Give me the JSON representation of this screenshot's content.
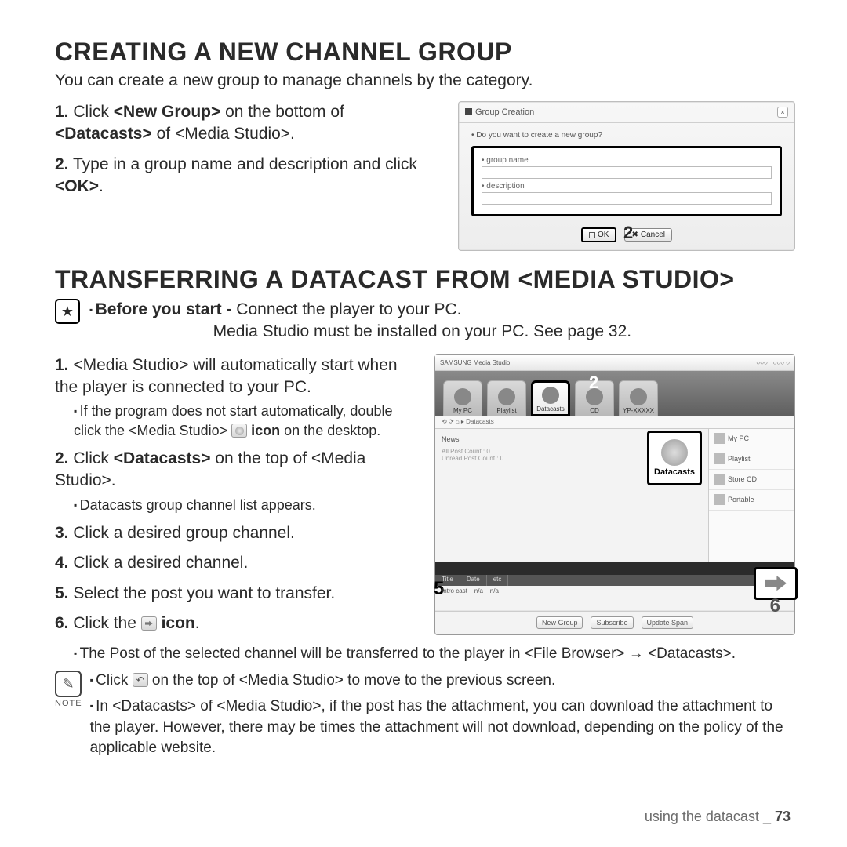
{
  "section1": {
    "title": "CREATING A NEW CHANNEL GROUP",
    "lead": "You can create a new group to manage channels by the category.",
    "steps": [
      {
        "n": "1.",
        "pre": "Click ",
        "b1": "<New Group>",
        "mid": " on the bottom of ",
        "b2": "<Datacasts>",
        "post": " of <Media Studio>."
      },
      {
        "n": "2.",
        "pre": "Type in a group name and description and click ",
        "b1": "<OK>",
        "post": "."
      }
    ]
  },
  "dialog": {
    "title": "Group Creation",
    "question": "Do you want to create a new group?",
    "label_group": "group name",
    "label_desc": "description",
    "callout": "2",
    "ok": "OK",
    "cancel": "Cancel"
  },
  "section2": {
    "title": "TRANSFERRING A DATACAST FROM <MEDIA STUDIO>",
    "before_label": "Before you start - ",
    "before_line1": "Connect the player to your PC.",
    "before_line2": "Media Studio must be installed on your PC. See page 32.",
    "step1": {
      "n": "1.",
      "text": "<Media Studio> will automatically start when the player is connected to your PC."
    },
    "step1_sub_pre": "If the program does not start automatically, double click the <Media Studio> ",
    "step1_sub_post": " on the desktop.",
    "step1_sub_bold": "icon",
    "step2": {
      "n": "2.",
      "pre": "Click ",
      "b": "<Datacasts>",
      "post": " on the top of <Media Studio>."
    },
    "step2_sub": "Datacasts group channel list appears.",
    "step3": {
      "n": "3.",
      "text": "Click a desired group channel."
    },
    "step4": {
      "n": "4.",
      "text": "Click a desired channel."
    },
    "step5": {
      "n": "5.",
      "text": "Select the post you want to transfer."
    },
    "step6": {
      "n": "6.",
      "pre": "Click the ",
      "b": "icon",
      "post": "."
    },
    "step6_sub": "The Post of the selected channel will be transferred to the player in <File Browser> → <Datacasts>."
  },
  "studio": {
    "tabs": [
      "My PC",
      "Playlist",
      "Datacasts",
      "CD",
      "YP-XXXXX"
    ],
    "callout_tabs": "2",
    "path": "Datacasts",
    "left_title": "News",
    "big_label": "Datacasts",
    "right_items": [
      "My PC",
      "Playlist",
      "Store CD",
      "Portable"
    ],
    "list_headers": [
      "Title",
      "Date",
      "etc"
    ],
    "callout_list": "5",
    "callout_transfer": "6",
    "bottom": [
      "New Group",
      "Subscribe",
      "Update Span"
    ]
  },
  "note": {
    "label": "NOTE",
    "line1_pre": "Click ",
    "line1_post": " on the top of <Media Studio> to move to the previous screen.",
    "line2": "In <Datacasts> of <Media Studio>, if the post has the attachment, you can download the attachment to the player. However, there may be times the attachment will not download, depending on the policy of the applicable website."
  },
  "footer": {
    "text": "using the datacast _ ",
    "page": "73"
  }
}
